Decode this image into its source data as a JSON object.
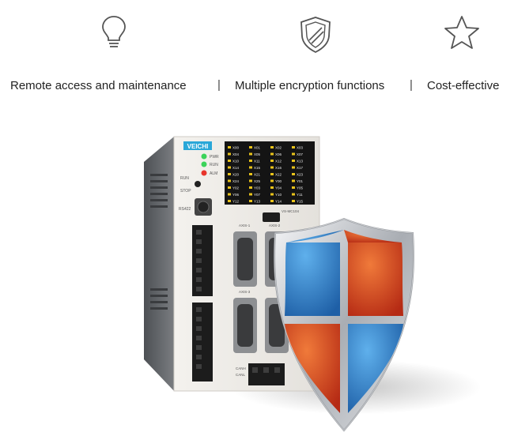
{
  "features": [
    {
      "label": "Remote access and maintenance",
      "icon": "lightbulb-icon"
    },
    {
      "label": "Multiple encryption functions",
      "icon": "shield-icon"
    },
    {
      "label": "Cost-effective",
      "icon": "star-icon"
    }
  ],
  "separators": [
    "|",
    "|"
  ],
  "device": {
    "brand": "VEICHI",
    "model": "VS-MC104",
    "leds": [
      {
        "label": "PWR",
        "color": "#3bd35a"
      },
      {
        "label": "RUN",
        "color": "#3bd35a"
      },
      {
        "label": "ALM",
        "color": "#e8352c"
      }
    ],
    "switch_labels": [
      "RUN",
      "STOP"
    ],
    "port_label": "RS422",
    "axis_labels": [
      "AXIS-1",
      "AXIS-2",
      "AXIS-3"
    ],
    "can_labels": [
      "CANH",
      "CANL"
    ],
    "io_labels": [
      "X00",
      "X01",
      "X02",
      "X03",
      "X04",
      "X05",
      "X06",
      "X07",
      "X10",
      "X11",
      "X12",
      "X13",
      "X14",
      "X15",
      "X16",
      "X17",
      "X20",
      "X21",
      "X22",
      "X23",
      "X24",
      "X25",
      "Y00",
      "Y01",
      "Y02",
      "Y03",
      "Y04",
      "Y05",
      "Y06",
      "Y07",
      "Y10",
      "Y11",
      "Y12",
      "Y13",
      "Y14",
      "Y15"
    ]
  },
  "colors": {
    "shield_blue": "#2f7fc6",
    "shield_red": "#d8431f",
    "shield_silver": "#c9ccd0",
    "device_body": "#ece9e4",
    "device_side": "#6b6e72"
  }
}
